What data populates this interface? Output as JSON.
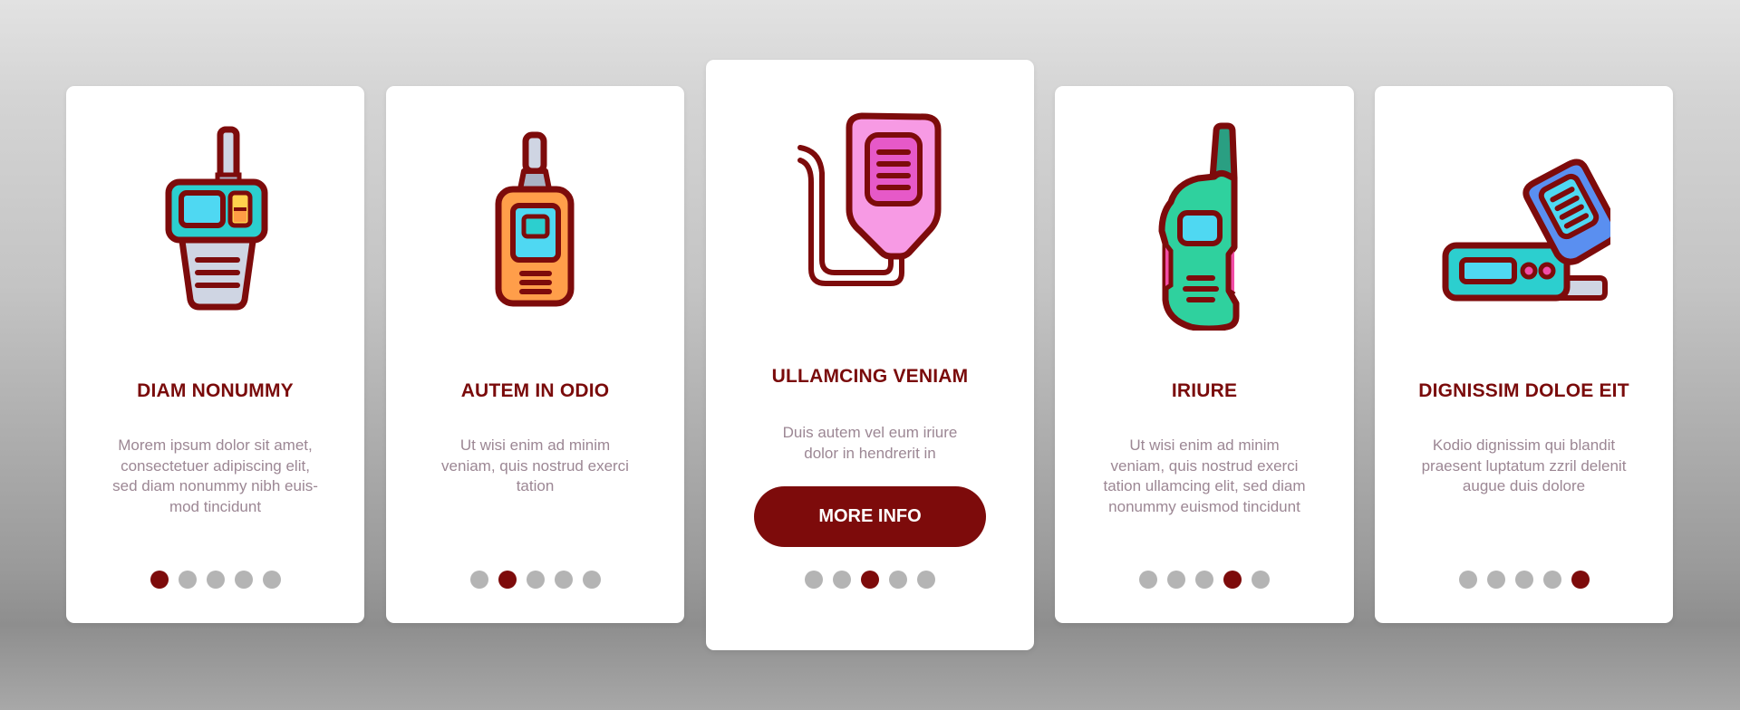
{
  "colors": {
    "accent": "#7d0b0b",
    "title": "#7a0b0b",
    "body_text": "#9c8794",
    "dot_inactive": "#b4b4b4",
    "card_bg": "#ffffff"
  },
  "cards": [
    {
      "icon": "handheld-radio-icon",
      "title": "DIAM NONUMMY",
      "body": "Morem ipsum dolor sit amet, consectetuer adipiscing elit, sed diam nonummy nibh euis-mod tincidunt",
      "body_lines": [
        "Morem ipsum dolor sit amet,",
        "consectetuer adipiscing elit,",
        "sed diam nonummy nibh euis-",
        "mod tincidunt"
      ],
      "active_page": 1,
      "page_count": 5
    },
    {
      "icon": "walkie-talkie-icon",
      "title": "AUTEM IN ODIO",
      "body_lines": [
        "Ut wisi enim ad minim",
        "veniam, quis nostrud exerci",
        "tation"
      ],
      "active_page": 2,
      "page_count": 5
    },
    {
      "icon": "speaker-microphone-icon",
      "title": "ULLAMCING VENIAM",
      "body_lines": [
        "Duis autem vel eum iriure",
        "dolor in hendrerit in"
      ],
      "button_label": "MORE INFO",
      "active_page": 3,
      "page_count": 5
    },
    {
      "icon": "two-way-radio-icon",
      "title": "IRIURE",
      "body_lines": [
        "Ut wisi enim ad minim",
        "veniam, quis nostrud exerci",
        "tation ullamcing elit, sed diam",
        "nonummy euismod tincidunt"
      ],
      "active_page": 4,
      "page_count": 5
    },
    {
      "icon": "car-radio-transceiver-icon",
      "title": "DIGNISSIM DOLOE EIT",
      "body_lines": [
        "Kodio dignissim qui blandit",
        "praesent luptatum zzril delenit",
        "augue duis dolore"
      ],
      "active_page": 5,
      "page_count": 5
    }
  ]
}
